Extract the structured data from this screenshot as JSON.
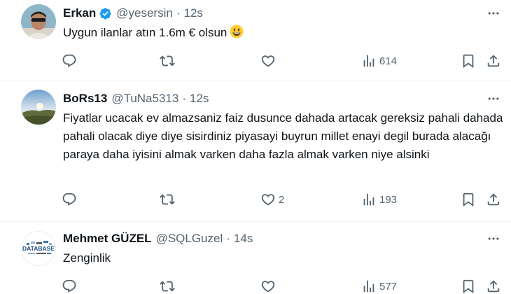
{
  "colors": {
    "text_primary": "#0f1419",
    "text_secondary": "#536471",
    "divider": "#eff3f4",
    "verified_blue": "#1d9bf0"
  },
  "tweets": [
    {
      "display_name": "Erkan",
      "handle": "@yesersin",
      "separator": "·",
      "time": "12s",
      "verified": true,
      "text": "Uygun ilanlar atın 1.6m € olsun",
      "emoji": "grinning-face",
      "stats": {
        "replies": "",
        "retweets": "",
        "likes": "",
        "views": "614"
      }
    },
    {
      "display_name": "BoRs13",
      "handle": "@TuNa5313",
      "separator": "·",
      "time": "12s",
      "verified": false,
      "text": "Fiyatlar ucacak ev almazsaniz faiz dusunce dahada artacak gereksiz pahali dahada pahali olacak diye diye sisirdiniz piyasayi buyrun millet enayi degil burada alacağı paraya daha iyisini almak varken daha fazla almak varken niye alsinki",
      "stats": {
        "replies": "",
        "retweets": "",
        "likes": "2",
        "views": "193"
      }
    },
    {
      "display_name": "Mehmet GÜZEL",
      "handle": "@SQLGuzel",
      "separator": "·",
      "time": "14s",
      "verified": false,
      "text": "Zenginlik",
      "avatar_logo_text": "DATABASE",
      "stats": {
        "replies": "",
        "retweets": "",
        "likes": "",
        "views": "577"
      }
    }
  ]
}
